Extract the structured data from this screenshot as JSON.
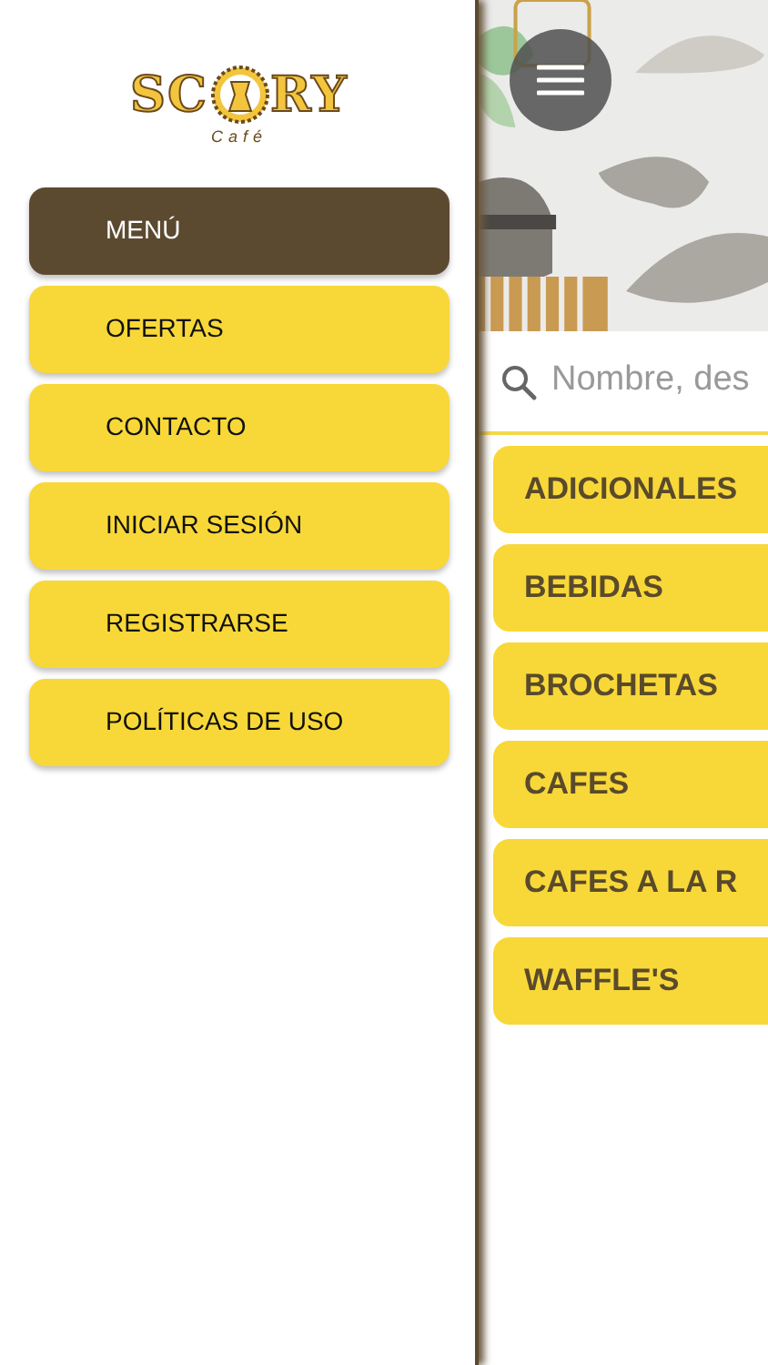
{
  "logo": {
    "left": "SC",
    "right": "RY",
    "sub": "Café"
  },
  "drawer": [
    {
      "label": "MENÚ",
      "selected": true
    },
    {
      "label": "OFERTAS",
      "selected": false
    },
    {
      "label": "CONTACTO",
      "selected": false
    },
    {
      "label": "INICIAR SESIÓN",
      "selected": false
    },
    {
      "label": "REGISTRARSE",
      "selected": false
    },
    {
      "label": "POLÍTICAS DE USO",
      "selected": false
    }
  ],
  "search": {
    "placeholder": "Nombre, des"
  },
  "categories": [
    "ADICIONALES",
    "BEBIDAS",
    "BROCHETAS",
    "CAFES",
    "CAFES A LA R",
    "WAFFLE'S"
  ]
}
